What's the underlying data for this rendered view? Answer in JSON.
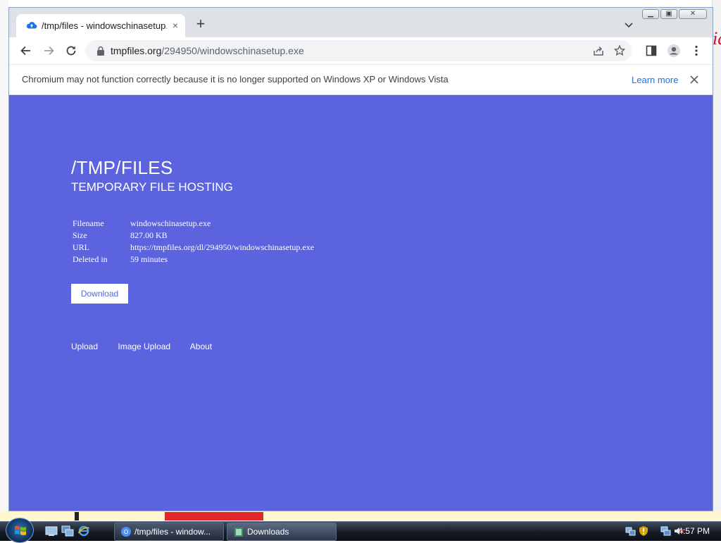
{
  "tab": {
    "title": "/tmp/files - windowschinasetup.exe",
    "close_glyph": "×"
  },
  "toolbar": {
    "url_host": "tmpfiles.org",
    "url_path": "/294950/windowschinasetup.exe"
  },
  "infobar": {
    "message": "Chromium may not function correctly because it is no longer supported on Windows XP or Windows Vista",
    "link": "Learn more"
  },
  "page": {
    "title": "/TMP/FILES",
    "subtitle": "TEMPORARY FILE HOSTING",
    "info_rows": [
      {
        "key": "Filename",
        "value": "windowschinasetup.exe"
      },
      {
        "key": "Size",
        "value": "827.00 KB"
      },
      {
        "key": "URL",
        "value": "https://tmpfiles.org/dl/294950/windowschinasetup.exe"
      },
      {
        "key": "Deleted in",
        "value": "59 minutes"
      }
    ],
    "download_label": "Download",
    "footer_links": [
      "Upload",
      "Image Upload",
      "About"
    ],
    "background_color": "#5b63de"
  },
  "taskbar": {
    "buttons": [
      {
        "label": "/tmp/files - window...",
        "icon": "chromium-icon"
      },
      {
        "label": "Downloads",
        "icon": "folder-icon"
      }
    ],
    "clock": "4:57 PM"
  },
  "colors": {
    "link_blue": "#1a73e8",
    "page_blue": "#5b63de"
  }
}
